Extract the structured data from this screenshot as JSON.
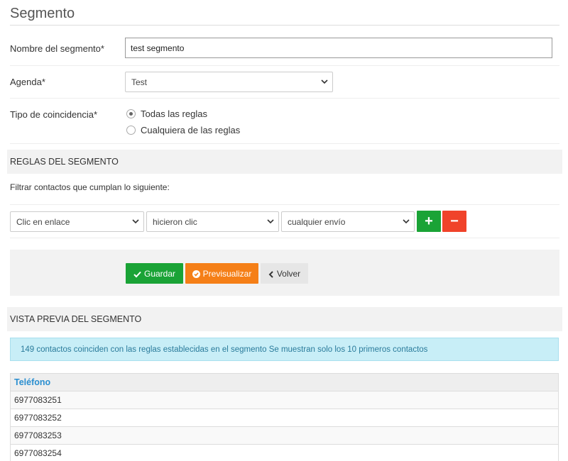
{
  "page": {
    "title": "Segmento"
  },
  "form": {
    "segment_name": {
      "label": "Nombre del segmento*",
      "value": "test segmento"
    },
    "agenda": {
      "label": "Agenda*",
      "value": "Test"
    },
    "match_type": {
      "label": "Tipo de coincidencia*",
      "options": [
        {
          "label": "Todas las reglas",
          "selected": true
        },
        {
          "label": "Cualquiera de las reglas",
          "selected": false
        }
      ]
    }
  },
  "rules_section": {
    "title": "REGLAS DEL SEGMENTO",
    "filter_text": "Filtrar contactos que cumplan lo siguiente:",
    "rule": {
      "field": "Clic en enlace",
      "operator": "hicieron clic",
      "value": "cualquier envío"
    },
    "add_label": "+",
    "remove_label": "−"
  },
  "actions": {
    "save": "Guardar",
    "preview": "Previsualizar",
    "back": "Volver"
  },
  "preview_section": {
    "title": "VISTA PREVIA DEL SEGMENTO",
    "info": "149 contactos coinciden con las reglas establecidas en el segmento Se muestran solo los 10 primeros contactos",
    "columns": [
      "Teléfono"
    ],
    "rows": [
      "6977083251",
      "6977083252",
      "6977083253",
      "6977083254"
    ]
  },
  "colors": {
    "success": "#1aa336",
    "danger": "#f0432a",
    "warning": "#f57f17",
    "info_bg": "#c8eef7",
    "header_link": "#2b8fd0"
  }
}
